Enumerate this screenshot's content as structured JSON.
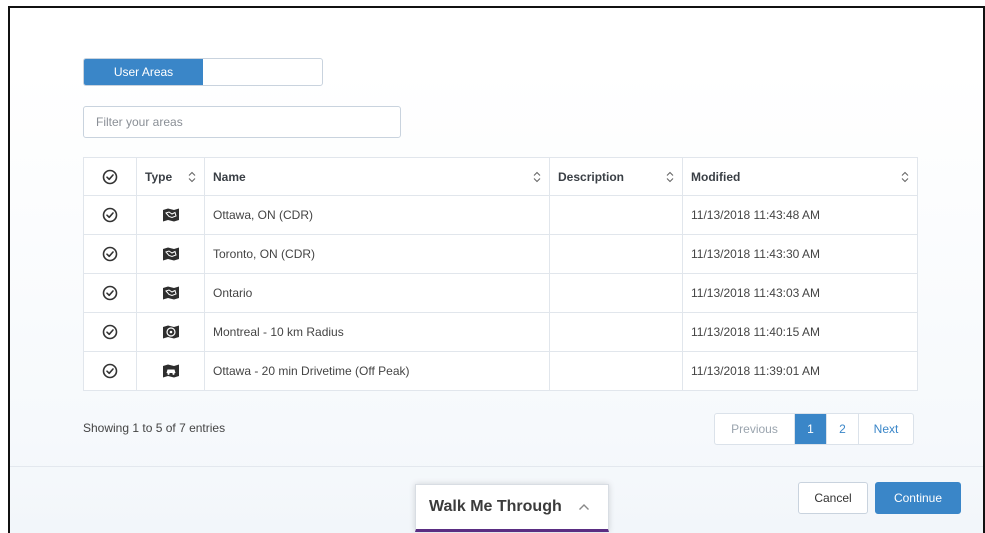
{
  "tabs": [
    {
      "label": "User Areas",
      "active": true
    },
    {
      "label": "",
      "active": false
    }
  ],
  "filter": {
    "placeholder": "Filter your areas",
    "value": ""
  },
  "table": {
    "headers": {
      "check": "",
      "type": "Type",
      "name": "Name",
      "description": "Description",
      "modified": "Modified"
    },
    "rows": [
      {
        "type_icon": "polygon-area-icon",
        "name": "Ottawa, ON (CDR)",
        "description": "",
        "modified": "11/13/2018 11:43:48 AM"
      },
      {
        "type_icon": "polygon-area-icon",
        "name": "Toronto, ON (CDR)",
        "description": "",
        "modified": "11/13/2018 11:43:30 AM"
      },
      {
        "type_icon": "polygon-area-icon",
        "name": "Ontario",
        "description": "",
        "modified": "11/13/2018 11:43:03 AM"
      },
      {
        "type_icon": "radius-icon",
        "name": "Montreal - 10 km Radius",
        "description": "",
        "modified": "11/13/2018 11:40:15 AM"
      },
      {
        "type_icon": "drivetime-car-icon",
        "name": "Ottawa - 20 min Drivetime (Off Peak)",
        "description": "",
        "modified": "11/13/2018 11:39:01 AM"
      }
    ]
  },
  "showing_text": "Showing 1 to 5 of 7 entries",
  "pager": {
    "previous": "Previous",
    "pages": [
      "1",
      "2"
    ],
    "active_page": "1",
    "next": "Next"
  },
  "buttons": {
    "cancel": "Cancel",
    "continue": "Continue"
  },
  "walkme": {
    "label": "Walk Me Through"
  },
  "colors": {
    "accent": "#3a86c8",
    "walkme_border": "#5a2d82"
  }
}
